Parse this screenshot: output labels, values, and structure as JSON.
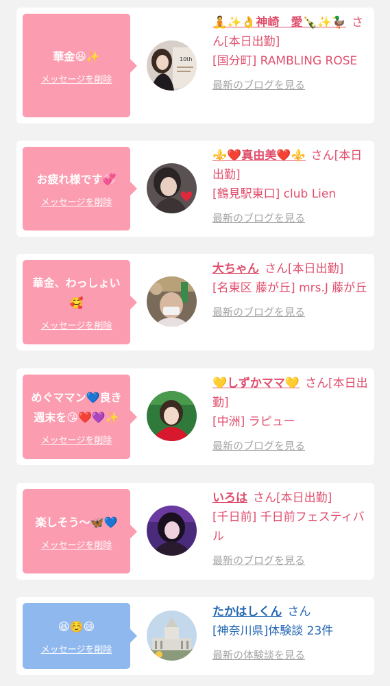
{
  "colors": {
    "pink": "#fc9cb0",
    "blue": "#8fb8ef",
    "name_pink": "#e04e6c",
    "name_blue": "#2467b3",
    "link_gray": "#a4a4a4",
    "background": "#f2f2f2"
  },
  "cards": [
    {
      "bubble_color": "pink",
      "message": "華金😆✨",
      "delete_label": "メッセージを削除",
      "name": "🧘✨👌神崎　愛🍾✨🦆",
      "suffix": "さん[本日出勤]",
      "detail": "[国分町] RAMBLING ROSE",
      "link": "最新のブログを見る",
      "avatar_icon": "avatar-photo-woman-poster"
    },
    {
      "bubble_color": "pink",
      "message": "お疲れ様です💞",
      "delete_label": "メッセージを削除",
      "name": "⚜️❤️真由美❤️⚜️",
      "suffix": "さん[本日出勤]",
      "detail": "[鶴見駅東口] club Lien",
      "link": "最新のブログを見る",
      "avatar_icon": "avatar-photo-woman-heart"
    },
    {
      "bubble_color": "pink",
      "message": "華金、わっしょい🥰",
      "delete_label": "メッセージを削除",
      "name": "大ちゃん",
      "suffix": "さん[本日出勤]",
      "detail": "[名東区 藤が丘] mrs.J 藤が丘",
      "link": "最新のブログを見る",
      "avatar_icon": "avatar-photo-man-mask"
    },
    {
      "bubble_color": "pink",
      "message": "めぐママン💙良き週末を😘❤️💜✨",
      "delete_label": "メッセージを削除",
      "name": "💛しずかママ💛",
      "suffix": "さん[本日出勤]",
      "detail": "[中洲] ラピュー",
      "link": "最新のブログを見る",
      "avatar_icon": "avatar-photo-woman-red"
    },
    {
      "bubble_color": "pink",
      "message": "楽しそう〜🦋💙",
      "delete_label": "メッセージを削除",
      "name": "いろは",
      "suffix": "さん[本日出勤]",
      "detail": "[千日前] 千日前フェスティバル",
      "link": "最新のブログを見る",
      "avatar_icon": "avatar-photo-woman-purple"
    },
    {
      "bubble_color": "blue",
      "message": "😆☺️😄",
      "delete_label": "メッセージを削除",
      "name": "たかはしくん",
      "suffix": "さん",
      "detail": "[神奈川県]体験談 23件",
      "link": "最新の体験談を見る",
      "avatar_icon": "avatar-photo-diet-building"
    }
  ]
}
